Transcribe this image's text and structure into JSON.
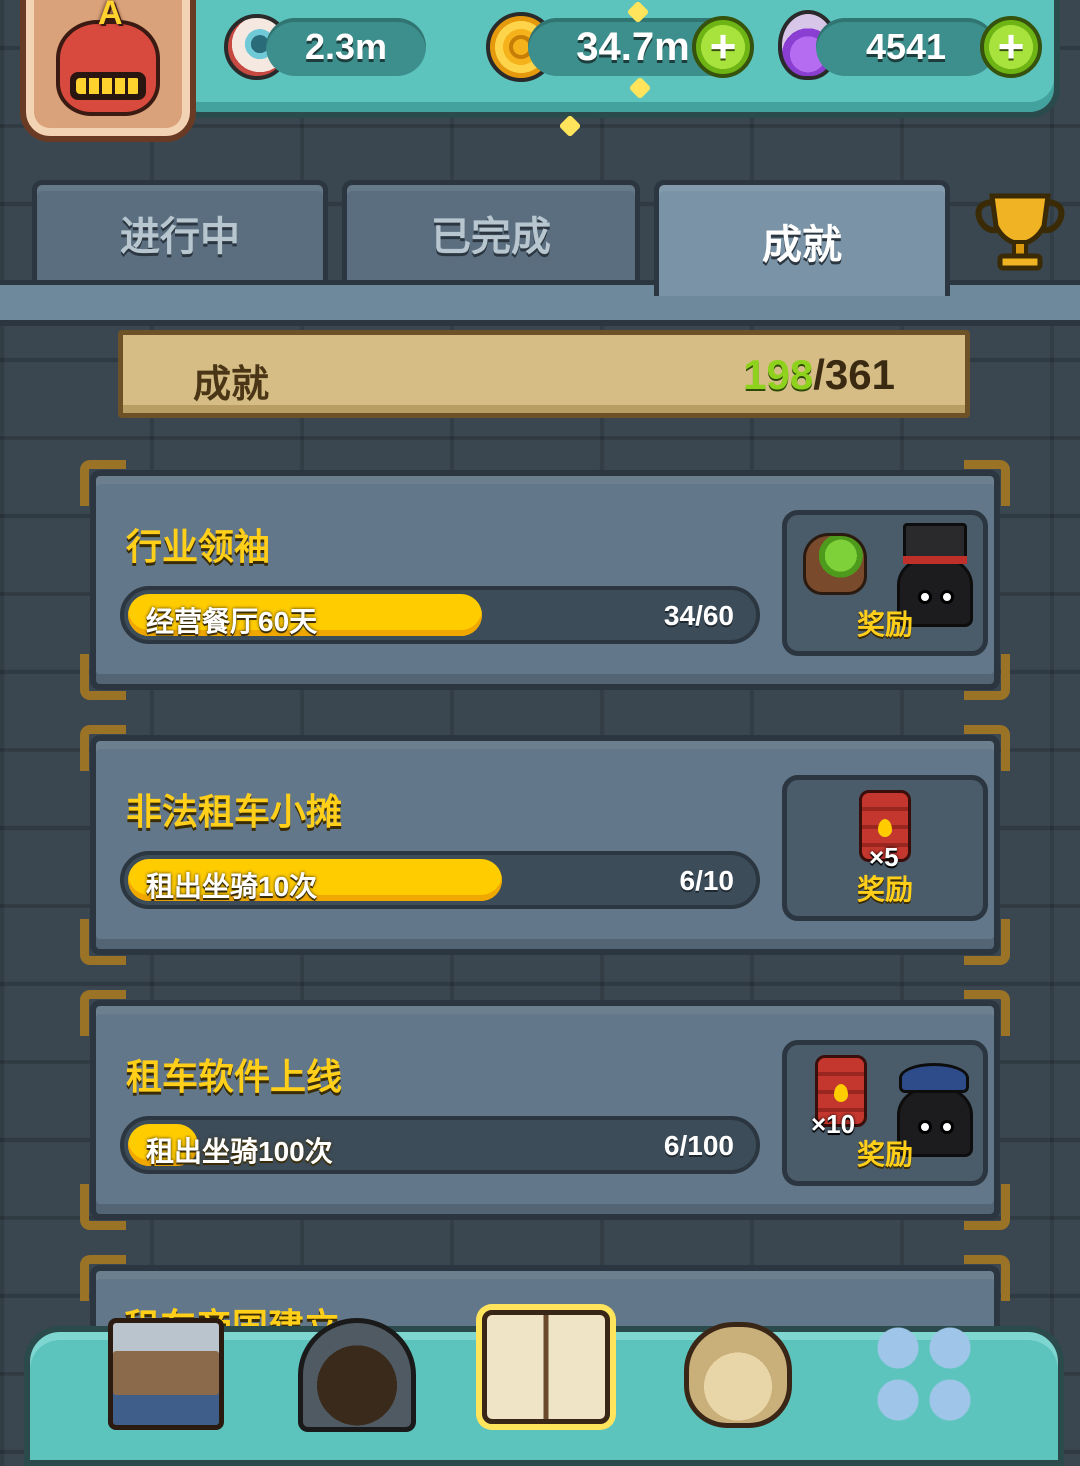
{
  "resources": {
    "eyes": "2.3m",
    "coins": "34.7m",
    "potions": "4541"
  },
  "tabs": [
    {
      "label": "进行中"
    },
    {
      "label": "已完成"
    },
    {
      "label": "成就"
    }
  ],
  "summary": {
    "title": "成就",
    "completed": "198",
    "separator": "/",
    "total": "361"
  },
  "achievements": [
    {
      "title": "行业领袖",
      "task": "经营餐厅60天",
      "count": "34/60",
      "progress": 0.5667,
      "reward_label": "奖励",
      "reward_items": [
        {
          "icon": "plant-icon"
        },
        {
          "icon": "top-hat-monster-icon"
        }
      ]
    },
    {
      "title": "非法租车小摊",
      "task": "租出坐骑10次",
      "count": "6/10",
      "progress": 0.6,
      "reward_label": "奖励",
      "reward_items": [
        {
          "icon": "oil-barrel-icon",
          "qty": "×5"
        }
      ]
    },
    {
      "title": "租车软件上线",
      "task": "租出坐骑100次",
      "count": "6/100",
      "progress": 0.06,
      "reward_label": "奖励",
      "reward_items": [
        {
          "icon": "oil-barrel-icon",
          "qty": "×10"
        },
        {
          "icon": "police-cap-monster-icon"
        }
      ]
    },
    {
      "title": "租车帝国建立"
    }
  ],
  "nav": [
    {
      "icon": "shop-icon"
    },
    {
      "icon": "monster-lair-icon"
    },
    {
      "icon": "book-icon",
      "active": true
    },
    {
      "icon": "money-bag-icon"
    },
    {
      "icon": "grid-menu-icon"
    }
  ]
}
